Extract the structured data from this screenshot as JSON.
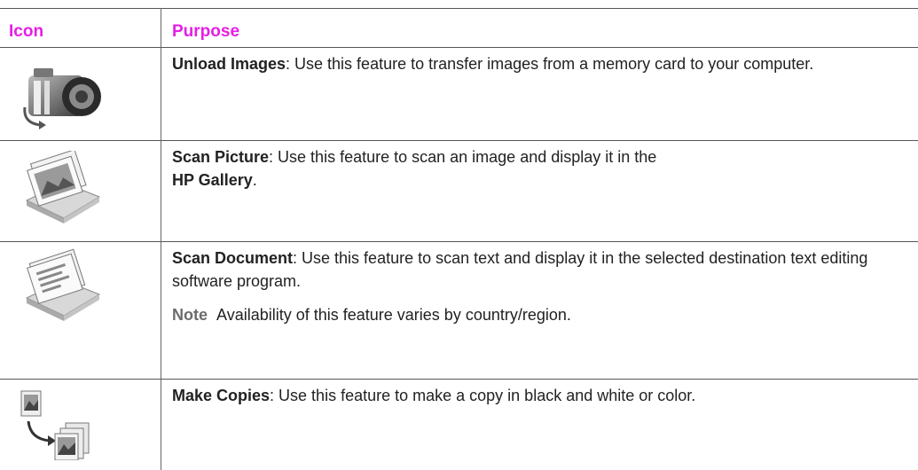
{
  "header": {
    "col_icon": "Icon",
    "col_purpose": "Purpose"
  },
  "rows": [
    {
      "icon": "camera-icon",
      "title": "Unload Images",
      "text": ": Use this feature to transfer images from a memory card to your computer."
    },
    {
      "icon": "scan-picture-icon",
      "title": "Scan Picture",
      "text": ": Use this feature to scan an image and display it in the ",
      "title2": "HP Gallery",
      "text2": "."
    },
    {
      "icon": "scan-document-icon",
      "title": "Scan Document",
      "text": ": Use this feature to scan text and display it in the selected destination text editing software program.",
      "note_label": "Note",
      "note_text": "Availability of this feature varies by country/region."
    },
    {
      "icon": "copies-icon",
      "title": "Make Copies",
      "text": ": Use this feature to make a copy in black and white or color."
    }
  ],
  "colors": {
    "header_text": "#e61ee6",
    "rule": "#555555"
  }
}
